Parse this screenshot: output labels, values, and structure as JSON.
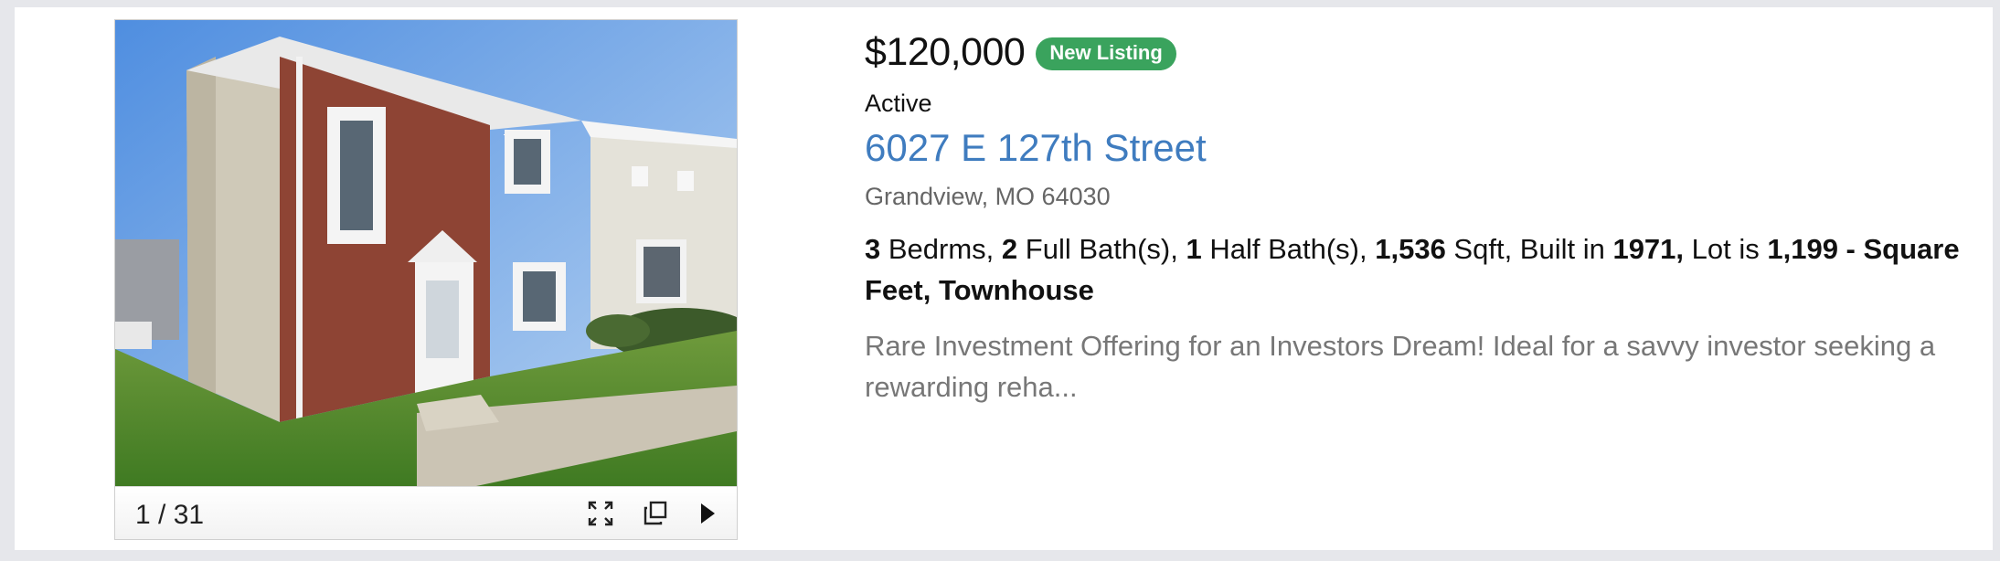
{
  "listing": {
    "price": "$120,000",
    "badge": "New Listing",
    "status": "Active",
    "address": "6027 E 127th Street",
    "city_state_zip": "Grandview, MO 64030",
    "facts": {
      "bedrooms": "3",
      "bedrooms_label": " Bedrms, ",
      "full_baths": "2",
      "full_baths_label": " Full Bath(s), ",
      "half_baths": "1",
      "half_baths_label": " Half Bath(s), ",
      "sqft": "1,536",
      "sqft_label": " Sqft, Built in ",
      "year_built": "1971,",
      "lot_label": " Lot is ",
      "lot": "1,199 - Square Feet, Townhouse"
    },
    "description": "Rare Investment Offering for an Investors Dream! Ideal for a savvy investor seeking a rewarding reha..."
  },
  "gallery": {
    "counter": "1 / 31",
    "photo_alt": "two-story brick townhouse exterior"
  },
  "icons": {
    "fullscreen": "fullscreen-icon",
    "open_new": "open-in-new-window-icon",
    "next": "play-next-icon"
  },
  "colors": {
    "badge": "#3aa35d",
    "address_link": "#3f7cbf",
    "muted_text": "#777777"
  }
}
